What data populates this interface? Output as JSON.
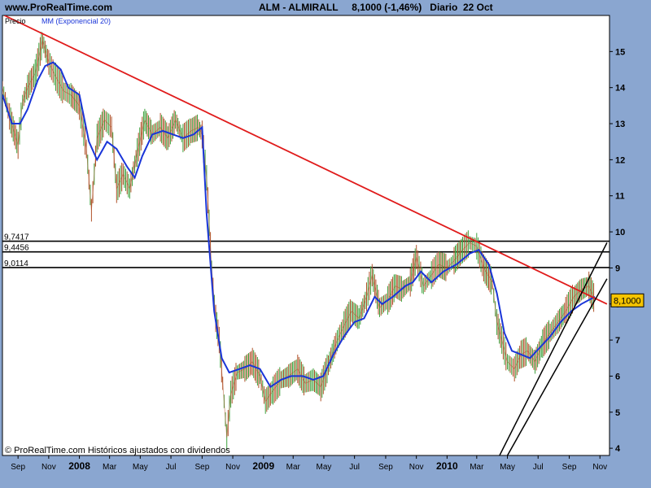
{
  "header": {
    "site": "www.ProRealTime.com",
    "ticker": "ALM - ALMIRALL",
    "price": "8,1000 (-1,46%)",
    "period": "Diario",
    "date": "22 Oct"
  },
  "legend": {
    "series1": "Precio",
    "series2": "MM (Exponencial 20)"
  },
  "copyright": "© ProRealTime.com Históricos ajustados con dividendos",
  "colors": {
    "background": "#8aa6d0",
    "plot": "#ffffff",
    "price": "#b0522a",
    "price_up": "#3fa33f",
    "ma": "#1a35d8",
    "trend": "#e01b1b",
    "channel": "#000000",
    "last_price_box": "#f5c400"
  },
  "chart_data": {
    "type": "line",
    "x_tick_labels": [
      "Sep",
      "Nov",
      "2008",
      "Mar",
      "May",
      "Jul",
      "Sep",
      "Nov",
      "2009",
      "Mar",
      "May",
      "Jul",
      "Sep",
      "Nov",
      "2010",
      "Mar",
      "May",
      "Jul",
      "Sep",
      "Nov"
    ],
    "y_tick_labels": [
      "4",
      "5",
      "6",
      "7",
      "8",
      "9",
      "10",
      "11",
      "12",
      "13",
      "14",
      "15"
    ],
    "ylim": [
      3.8,
      16.0
    ],
    "last_price": "8,1000",
    "series": [
      {
        "name": "Precio",
        "points": [
          [
            "2007-08-01",
            14.0
          ],
          [
            "2007-08-15",
            13.2
          ],
          [
            "2007-09-01",
            12.4
          ],
          [
            "2007-09-10",
            13.6
          ],
          [
            "2007-09-20",
            14.0
          ],
          [
            "2007-10-05",
            14.4
          ],
          [
            "2007-10-20",
            15.3
          ],
          [
            "2007-11-01",
            14.7
          ],
          [
            "2007-11-15",
            14.3
          ],
          [
            "2007-12-01",
            13.9
          ],
          [
            "2007-12-15",
            13.8
          ],
          [
            "2008-01-01",
            13.5
          ],
          [
            "2008-01-15",
            12.3
          ],
          [
            "2008-01-25",
            10.6
          ],
          [
            "2008-02-05",
            12.6
          ],
          [
            "2008-02-20",
            13.1
          ],
          [
            "2008-03-05",
            12.9
          ],
          [
            "2008-03-15",
            11.2
          ],
          [
            "2008-03-28",
            11.6
          ],
          [
            "2008-04-10",
            11.2
          ],
          [
            "2008-04-25",
            12.2
          ],
          [
            "2008-05-10",
            13.1
          ],
          [
            "2008-05-25",
            12.7
          ],
          [
            "2008-06-10",
            12.9
          ],
          [
            "2008-06-25",
            12.6
          ],
          [
            "2008-07-10",
            13.1
          ],
          [
            "2008-07-25",
            12.6
          ],
          [
            "2008-08-10",
            12.8
          ],
          [
            "2008-08-25",
            12.9
          ],
          [
            "2008-09-01",
            12.7
          ],
          [
            "2008-09-10",
            11.5
          ],
          [
            "2008-09-20",
            9.0
          ],
          [
            "2008-09-28",
            7.6
          ],
          [
            "2008-10-05",
            7.0
          ],
          [
            "2008-10-12",
            5.8
          ],
          [
            "2008-10-20",
            4.3
          ],
          [
            "2008-10-28",
            5.5
          ],
          [
            "2008-11-10",
            6.1
          ],
          [
            "2008-11-25",
            6.2
          ],
          [
            "2008-12-10",
            6.4
          ],
          [
            "2008-12-25",
            6.0
          ],
          [
            "2009-01-05",
            5.3
          ],
          [
            "2009-01-20",
            5.6
          ],
          [
            "2009-02-05",
            5.9
          ],
          [
            "2009-02-20",
            6.0
          ],
          [
            "2009-03-10",
            6.2
          ],
          [
            "2009-03-25",
            5.8
          ],
          [
            "2009-04-10",
            5.9
          ],
          [
            "2009-04-25",
            5.7
          ],
          [
            "2009-05-10",
            6.3
          ],
          [
            "2009-05-25",
            6.9
          ],
          [
            "2009-06-10",
            7.4
          ],
          [
            "2009-06-25",
            7.8
          ],
          [
            "2009-07-10",
            7.6
          ],
          [
            "2009-07-25",
            8.2
          ],
          [
            "2009-08-05",
            8.8
          ],
          [
            "2009-08-20",
            7.9
          ],
          [
            "2009-09-05",
            8.1
          ],
          [
            "2009-09-20",
            8.5
          ],
          [
            "2009-10-05",
            8.4
          ],
          [
            "2009-10-20",
            8.6
          ],
          [
            "2009-11-01",
            9.3
          ],
          [
            "2009-11-15",
            8.5
          ],
          [
            "2009-12-01",
            8.8
          ],
          [
            "2009-12-15",
            9.1
          ],
          [
            "2010-01-01",
            9.0
          ],
          [
            "2010-01-15",
            9.2
          ],
          [
            "2010-02-01",
            9.5
          ],
          [
            "2010-02-15",
            9.7
          ],
          [
            "2010-03-01",
            9.6
          ],
          [
            "2010-03-15",
            9.0
          ],
          [
            "2010-04-01",
            8.6
          ],
          [
            "2010-04-10",
            7.5
          ],
          [
            "2010-04-20",
            7.0
          ],
          [
            "2010-05-01",
            6.4
          ],
          [
            "2010-05-15",
            6.2
          ],
          [
            "2010-05-28",
            6.6
          ],
          [
            "2010-06-10",
            6.7
          ],
          [
            "2010-06-25",
            6.4
          ],
          [
            "2010-07-10",
            6.9
          ],
          [
            "2010-07-25",
            7.2
          ],
          [
            "2010-08-10",
            7.5
          ],
          [
            "2010-08-25",
            7.8
          ],
          [
            "2010-09-10",
            8.2
          ],
          [
            "2010-09-25",
            8.4
          ],
          [
            "2010-10-10",
            8.5
          ],
          [
            "2010-10-22",
            8.1
          ]
        ]
      },
      {
        "name": "MM (Exponencial 20)",
        "points": [
          [
            "2007-08-01",
            13.8
          ],
          [
            "2007-08-20",
            13.0
          ],
          [
            "2007-09-05",
            13.0
          ],
          [
            "2007-09-20",
            13.4
          ],
          [
            "2007-10-10",
            14.2
          ],
          [
            "2007-10-25",
            14.6
          ],
          [
            "2007-11-10",
            14.7
          ],
          [
            "2007-11-25",
            14.5
          ],
          [
            "2007-12-10",
            14.0
          ],
          [
            "2008-01-01",
            13.8
          ],
          [
            "2008-01-20",
            12.5
          ],
          [
            "2008-02-05",
            12.0
          ],
          [
            "2008-02-25",
            12.5
          ],
          [
            "2008-03-15",
            12.3
          ],
          [
            "2008-04-05",
            11.8
          ],
          [
            "2008-04-20",
            11.5
          ],
          [
            "2008-05-05",
            12.1
          ],
          [
            "2008-05-25",
            12.7
          ],
          [
            "2008-06-15",
            12.8
          ],
          [
            "2008-07-05",
            12.7
          ],
          [
            "2008-07-25",
            12.6
          ],
          [
            "2008-08-15",
            12.7
          ],
          [
            "2008-09-01",
            12.9
          ],
          [
            "2008-09-10",
            10.5
          ],
          [
            "2008-09-25",
            7.8
          ],
          [
            "2008-10-10",
            6.5
          ],
          [
            "2008-10-25",
            6.1
          ],
          [
            "2008-11-15",
            6.2
          ],
          [
            "2008-12-05",
            6.3
          ],
          [
            "2008-12-25",
            6.2
          ],
          [
            "2009-01-15",
            5.7
          ],
          [
            "2009-02-05",
            5.9
          ],
          [
            "2009-02-25",
            6.0
          ],
          [
            "2009-03-20",
            6.0
          ],
          [
            "2009-04-10",
            5.9
          ],
          [
            "2009-04-30",
            6.0
          ],
          [
            "2009-05-20",
            6.6
          ],
          [
            "2009-06-10",
            7.1
          ],
          [
            "2009-07-01",
            7.5
          ],
          [
            "2009-07-20",
            7.6
          ],
          [
            "2009-08-10",
            8.2
          ],
          [
            "2009-08-25",
            8.0
          ],
          [
            "2009-09-15",
            8.2
          ],
          [
            "2009-10-10",
            8.5
          ],
          [
            "2009-10-25",
            8.6
          ],
          [
            "2009-11-10",
            8.9
          ],
          [
            "2009-12-01",
            8.6
          ],
          [
            "2009-12-25",
            8.9
          ],
          [
            "2010-01-20",
            9.1
          ],
          [
            "2010-02-15",
            9.4
          ],
          [
            "2010-03-05",
            9.5
          ],
          [
            "2010-03-25",
            9.1
          ],
          [
            "2010-04-10",
            8.3
          ],
          [
            "2010-04-25",
            7.2
          ],
          [
            "2010-05-10",
            6.7
          ],
          [
            "2010-05-28",
            6.6
          ],
          [
            "2010-06-15",
            6.5
          ],
          [
            "2010-07-05",
            6.8
          ],
          [
            "2010-07-25",
            7.1
          ],
          [
            "2010-08-15",
            7.5
          ],
          [
            "2010-09-05",
            7.8
          ],
          [
            "2010-09-25",
            8.0
          ],
          [
            "2010-10-22",
            8.2
          ]
        ]
      }
    ],
    "horizontal_levels": [
      {
        "label": "9,7417",
        "value": 9.7417
      },
      {
        "label": "9,4456",
        "value": 9.4456
      },
      {
        "label": "9,0114",
        "value": 9.0114
      }
    ],
    "trendlines": [
      {
        "kind": "resistance",
        "color": "#e01b1b",
        "from": [
          "2007-08-05",
          16.0
        ],
        "to": [
          "2010-11-15",
          8.0
        ]
      },
      {
        "kind": "channel",
        "color": "#000000",
        "from": [
          "2010-04-10",
          3.65
        ],
        "to": [
          "2010-11-15",
          9.7
        ]
      },
      {
        "kind": "channel",
        "color": "#000000",
        "from": [
          "2010-04-25",
          3.65
        ],
        "to": [
          "2010-11-15",
          8.7
        ]
      }
    ]
  }
}
